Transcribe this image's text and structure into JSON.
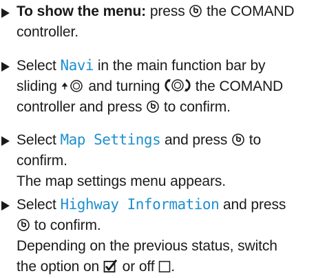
{
  "steps": [
    {
      "bold": "To show the menu:",
      "l1_a": " press ",
      "l1_b": " the COMAND",
      "l2": "controller."
    },
    {
      "l1_a": "Select ",
      "l1_kw": "Navi",
      "l1_b": " in the main function bar by",
      "l2_a": "sliding ",
      "l2_b": " and turning ",
      "l2_c": " the COMAND",
      "l3_a": "controller and press ",
      "l3_b": " to confirm."
    },
    {
      "l1_a": "Select ",
      "l1_kw": "Map Settings",
      "l1_b": " and press ",
      "l1_c": " to",
      "l2": "confirm.",
      "l3": "The map settings menu appears."
    },
    {
      "l1_a": "Select ",
      "l1_kw": "Highway Information",
      "l1_b": " and press",
      "l2_b": " to confirm.",
      "l3": "Depending on the previous status, switch",
      "l4_a": "the option on ",
      "l4_b": " or off ",
      "l4_c": "."
    }
  ],
  "icons": {
    "press": "controller-press-icon",
    "slide_up": "controller-slide-up-icon",
    "turn": "controller-turn-icon",
    "checkbox_on": "checkbox-checked-icon",
    "checkbox_off": "checkbox-unchecked-icon"
  },
  "colors": {
    "keyword": "#1e8fcf",
    "text": "#1a1a1a"
  }
}
